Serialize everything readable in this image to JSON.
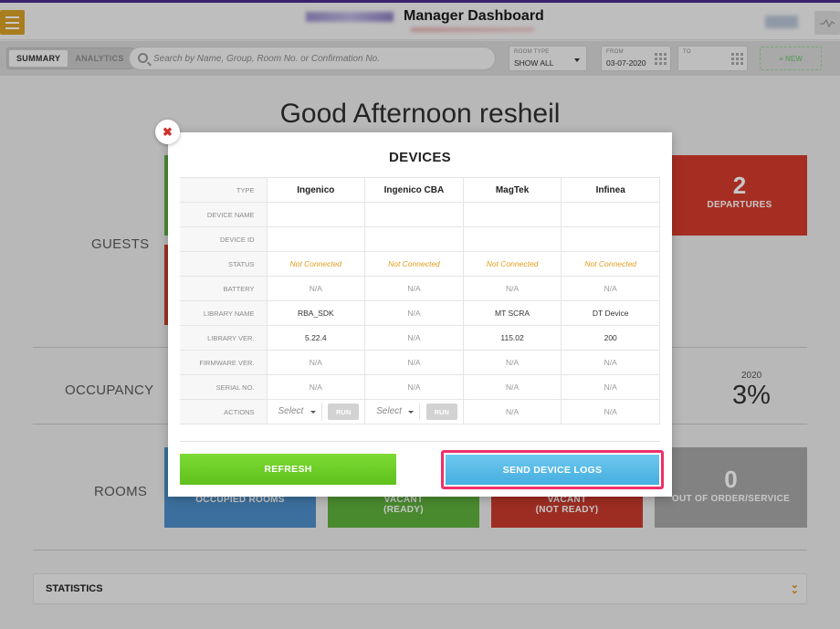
{
  "header": {
    "title": "Manager Dashboard"
  },
  "toolbar": {
    "tabs": [
      {
        "label": "SUMMARY"
      },
      {
        "label": "ANALYTICS"
      }
    ],
    "search_placeholder": "Search by Name, Group, Room No. or Confirmation No.",
    "room_type": {
      "label": "ROOM TYPE",
      "value": "SHOW ALL"
    },
    "from": {
      "label": "FROM",
      "value": "03-07-2020"
    },
    "to": {
      "label": "TO",
      "value": ""
    },
    "new_label": "+ NEW"
  },
  "dashboard": {
    "greeting": "Good Afternoon resheil",
    "sections": {
      "guests": "GUESTS",
      "occupancy": "OCCUPANCY",
      "rooms": "ROOMS"
    },
    "departures": {
      "value": "2",
      "label": "DEPARTURES"
    },
    "occupancy_year": "2020",
    "occupancy_value": "3%",
    "rooms": {
      "occupied_label": "OCCUPIED ROOMS",
      "vacant_ready_line1": "VACANT",
      "vacant_ready_line2": "(READY)",
      "vacant_not_ready_line1": "VACANT",
      "vacant_not_ready_line2": "(NOT READY)",
      "out_of_order_value": "0",
      "out_of_order_label": "OUT OF ORDER/SERVICE"
    },
    "statistics_label": "STATISTICS"
  },
  "modal": {
    "close_glyph": "✖",
    "title": "DEVICES",
    "header_label": "TYPE",
    "devices": [
      "Ingenico",
      "Ingenico CBA",
      "MagTek",
      "Infinea"
    ],
    "rows": [
      {
        "label": "DEVICE NAME",
        "values": [
          "",
          "",
          "",
          ""
        ]
      },
      {
        "label": "DEVICE ID",
        "values": [
          "",
          "",
          "",
          ""
        ]
      },
      {
        "label": "STATUS",
        "values": [
          "Not Connected",
          "Not Connected",
          "Not Connected",
          "Not Connected"
        ]
      },
      {
        "label": "BATTERY",
        "values": [
          "N/A",
          "N/A",
          "N/A",
          "N/A"
        ]
      },
      {
        "label": "LIBRARY NAME",
        "values": [
          "RBA_SDK",
          "N/A",
          "MT SCRA",
          "DT Device"
        ]
      },
      {
        "label": "LIBRARY VER.",
        "values": [
          "5.22.4",
          "N/A",
          "115.02",
          "200"
        ]
      },
      {
        "label": "FIRMWARE VER.",
        "values": [
          "N/A",
          "N/A",
          "N/A",
          "N/A"
        ]
      },
      {
        "label": "SERIAL NO.",
        "values": [
          "N/A",
          "N/A",
          "N/A",
          "N/A"
        ]
      }
    ],
    "actions": {
      "label": "ACTIONS",
      "select_label": "Select",
      "run_label": "RUN",
      "na_values": [
        "N/A",
        "N/A"
      ]
    },
    "refresh_label": "REFRESH",
    "send_logs_label": "SEND DEVICE LOGS"
  },
  "colors": {
    "brand_purple": "#4b2c8c",
    "menu_orange": "#d9a027",
    "refresh_green": "#6cc926",
    "send_logs_blue": "#56b8e6",
    "highlight_pink": "#ee2f6a",
    "status_orange": "#e39c1d"
  }
}
